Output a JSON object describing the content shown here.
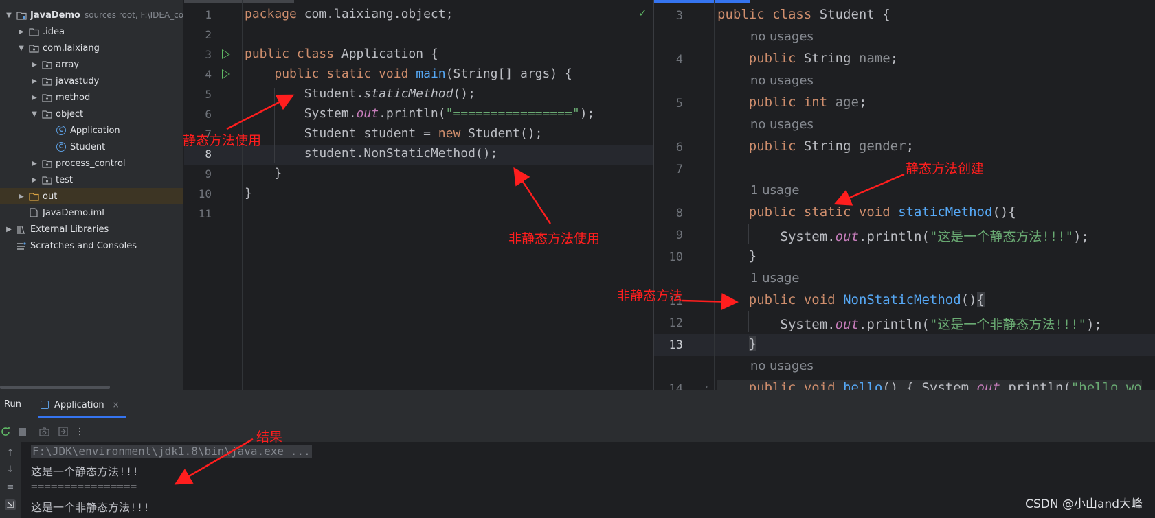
{
  "project_tree": {
    "items": [
      {
        "label": "JavaDemo",
        "hint": "sources root,  F:\\IDEA_co",
        "expanded": true,
        "icon": "module-folder-icon"
      },
      {
        "label": ".idea",
        "icon": "folder-icon"
      },
      {
        "label": "com.laixiang",
        "icon": "package-icon",
        "expanded": true
      },
      {
        "label": "array",
        "icon": "package-icon"
      },
      {
        "label": "javastudy",
        "icon": "package-icon"
      },
      {
        "label": "method",
        "icon": "package-icon"
      },
      {
        "label": "object",
        "icon": "package-icon",
        "expanded": true
      },
      {
        "label": "Application",
        "icon": "class-icon"
      },
      {
        "label": "Student",
        "icon": "class-icon"
      },
      {
        "label": "process_control",
        "icon": "package-icon"
      },
      {
        "label": "test",
        "icon": "package-icon"
      },
      {
        "label": "out",
        "icon": "folder-icon",
        "selected": true
      },
      {
        "label": "JavaDemo.iml",
        "icon": "file-icon"
      },
      {
        "label": "External Libraries",
        "icon": "libraries-icon"
      },
      {
        "label": "Scratches and Consoles",
        "icon": "scratches-icon"
      }
    ]
  },
  "editor_left": {
    "line_numbers": [
      "1",
      "2",
      "3",
      "4",
      "5",
      "6",
      "7",
      "8",
      "9",
      "10",
      "11"
    ],
    "current_line": "8",
    "lines": [
      "package com.laixiang.object;",
      "",
      "public class Application {",
      "    public static void main(String[] args) {",
      "        Student.staticMethod();",
      "        System.out.println(\"================\");",
      "        Student student = new Student();",
      "        student.NonStaticMethod();",
      "    }",
      "}",
      ""
    ],
    "status_icon": "checkmark-icon",
    "status_symbol": "✓"
  },
  "editor_right": {
    "line_numbers": [
      "3",
      "",
      "4",
      "",
      "5",
      "",
      "6",
      "7",
      "",
      "8",
      "9",
      "10",
      "",
      "11",
      "12",
      "13",
      "",
      "14"
    ],
    "current_line": "13",
    "hints": {
      "no_usages": "no usages",
      "one_usage": "1 usage"
    },
    "lines": [
      "public class Student {",
      "    public String name;",
      "    public int age;",
      "    public String gender;",
      "    public static void staticMethod(){",
      "        System.out.println(\"这是一个静态方法!!!\");",
      "    }",
      "    public void NonStaticMethod(){",
      "        System.out.println(\"这是一个非静态方法!!!\");",
      "    }",
      "    public void hello() { System.out.println(\"hello wo"
    ]
  },
  "run_panel": {
    "title": "Run",
    "tab_label": "Application",
    "tab_close": "×",
    "console_lines": [
      "F:\\JDK\\environment\\jdk1.8\\bin\\java.exe ...",
      "这是一个静态方法!!!",
      "================",
      "这是一个非静态方法!!!"
    ]
  },
  "annotations": {
    "static_use": "静态方法使用",
    "nonstatic_use": "非静态方法使用",
    "static_create": "静态方法创建",
    "nonstatic": "非静态方法",
    "result": "结果",
    "color": "#ff1e1e"
  },
  "watermark": "CSDN @小山and大峰",
  "colors": {
    "keyword": "#cf8e6d",
    "function": "#56a8f5",
    "string": "#6aab73",
    "static_field": "#c77dbb",
    "accent": "#3574f0",
    "run_icon": "#5fb865"
  }
}
